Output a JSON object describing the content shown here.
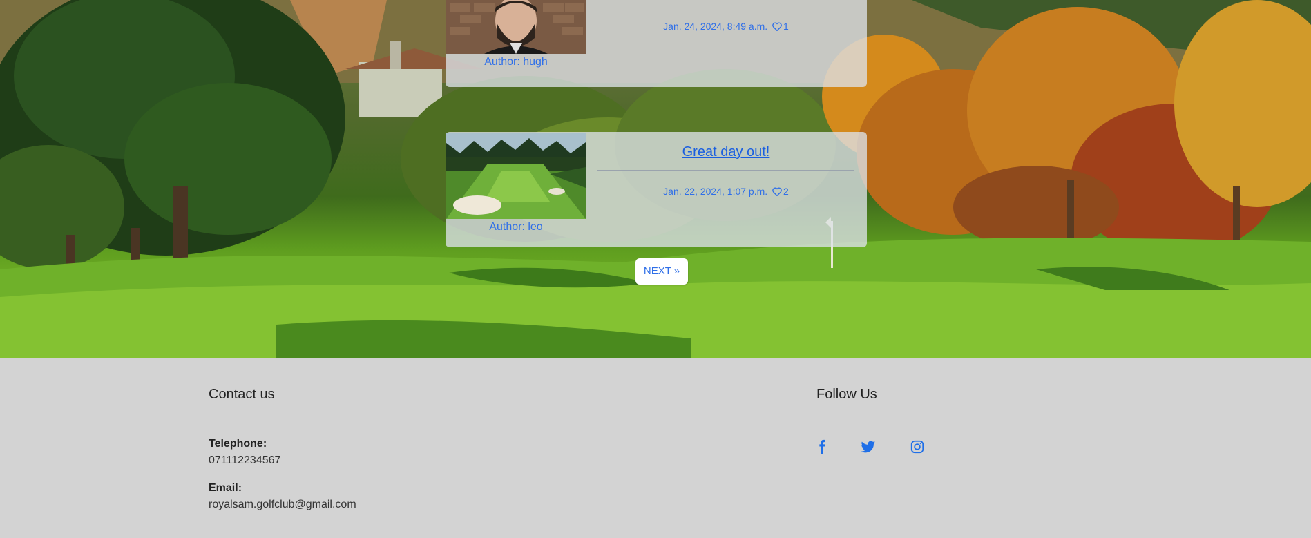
{
  "posts": [
    {
      "title": "",
      "author": "Author: hugh",
      "date": "Jan. 24, 2024, 8:49 a.m.",
      "likes": "1"
    },
    {
      "title": "Great day out!",
      "author": "Author: leo",
      "date": "Jan. 22, 2024, 1:07 p.m.",
      "likes": "2"
    }
  ],
  "pagination": {
    "next_label": "NEXT »"
  },
  "footer": {
    "contact_heading": "Contact us",
    "telephone_label": "Telephone:",
    "telephone_value": "071112234567",
    "email_label": "Email:",
    "email_value": "royalsam.golfclub@gmail.com",
    "follow_heading": "Follow Us"
  },
  "icons": {
    "facebook": "facebook-icon",
    "twitter": "twitter-icon",
    "instagram": "instagram-icon",
    "heart": "heart-icon"
  },
  "colors": {
    "link_blue": "#2f6fe8",
    "footer_bg": "#d3d3d3",
    "card_bg": "rgba(220,226,232,0.78)"
  }
}
